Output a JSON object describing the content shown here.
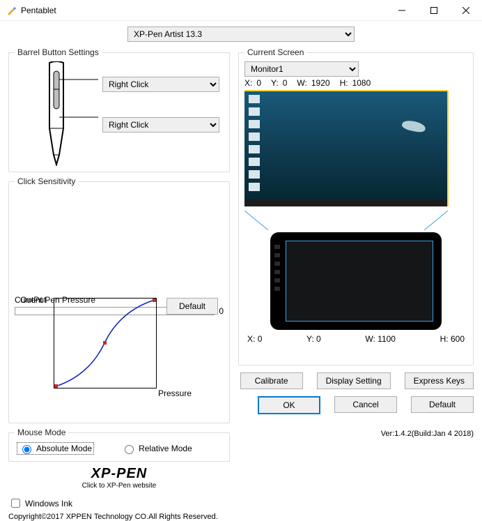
{
  "window": {
    "title": "Pentablet"
  },
  "device": {
    "selected": "XP-Pen Artist 13.3"
  },
  "barrel": {
    "legend": "Barrel Button Settings",
    "upper": "Right Click",
    "lower": "Right Click"
  },
  "sensitivity": {
    "legend": "Click Sensitivity",
    "output_label": "OutPut",
    "pressure_label": "Pressure",
    "default_btn": "Default",
    "current_label": "Current Pen Pressure",
    "current_value": "0"
  },
  "mouse": {
    "legend": "Mouse Mode",
    "absolute": "Absolute Mode",
    "relative": "Relative Mode"
  },
  "logo": {
    "brand": "XP-PEN",
    "sub": "Click to XP-Pen website"
  },
  "screen": {
    "legend": "Current Screen",
    "monitor": "Monitor1",
    "mon_x_label": "X:",
    "mon_x": "0",
    "mon_y_label": "Y:",
    "mon_y": "0",
    "mon_w_label": "W:",
    "mon_w": "1920",
    "mon_h_label": "H:",
    "mon_h": "1080",
    "tab_x_label": "X:",
    "tab_x": "0",
    "tab_y_label": "Y:",
    "tab_y": "0",
    "tab_w_label": "W:",
    "tab_w": "1100",
    "tab_h_label": "H:",
    "tab_h": "600"
  },
  "buttons": {
    "calibrate": "Calibrate",
    "display": "Display Setting",
    "express": "Express Keys",
    "ok": "OK",
    "cancel": "Cancel",
    "default": "Default"
  },
  "windows_ink": "Windows Ink",
  "copyright": "Copyright©2017 XPPEN Technology CO.All Rights Reserved.",
  "version": "Ver:1.4.2(Build:Jan  4 2018)"
}
